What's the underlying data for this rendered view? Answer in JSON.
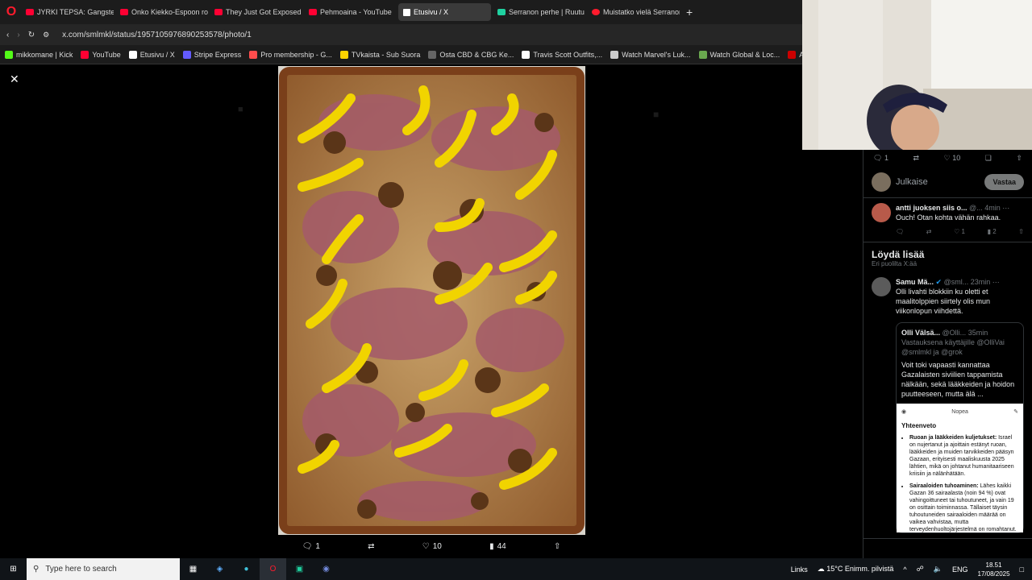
{
  "tabs": [
    {
      "label": "JYRKI TEPSA: Gangsteriel",
      "fav": "yt"
    },
    {
      "label": "Onko Kiekko-Espoon rom",
      "fav": "yt"
    },
    {
      "label": "They Just Got Exposed In",
      "fav": "yt"
    },
    {
      "label": "Pehmoaina - YouTube",
      "fav": "yt"
    },
    {
      "label": "Etusivu / X",
      "fav": "x",
      "active": true
    },
    {
      "label": "Serranon perhe | Ruutu",
      "fav": "r"
    },
    {
      "label": "Muistatko vielä Serranon",
      "fav": "o"
    }
  ],
  "address": {
    "url": "x.com/smlmkl/status/1957105976890253578/photo/1"
  },
  "bookmarks": [
    {
      "label": "mikkomane | Kick",
      "color": "#53fc18"
    },
    {
      "label": "YouTube",
      "color": "#ff0033"
    },
    {
      "label": "Etusivu / X",
      "color": "#ffffff"
    },
    {
      "label": "Stripe Express",
      "color": "#635bff"
    },
    {
      "label": "Pro membership - G...",
      "color": "#ff4d4d"
    },
    {
      "label": "TVkaista - Sub Suora",
      "color": "#ffd400"
    },
    {
      "label": "Osta CBD & CBG Ke...",
      "color": "#666666"
    },
    {
      "label": "Travis Scott Outfits,...",
      "color": "#ffffff"
    },
    {
      "label": "Watch Marvel's Luk...",
      "color": "#cccccc"
    },
    {
      "label": "Watch Global & Loc...",
      "color": "#6aa84f"
    },
    {
      "label": "A$AP ROCKY x PU...",
      "color": "#cc0000"
    }
  ],
  "photo_actions": {
    "replies": "1",
    "likes": "10",
    "views": "44"
  },
  "side": {
    "top_actions": {
      "replies": "1",
      "likes": "10"
    },
    "reply_placeholder": "Julkaise",
    "reply_button": "Vastaa",
    "reply_tweet": {
      "name": "antti juoksen siis o...",
      "handle": "@...",
      "time": "4min",
      "text": "Ouch! Otan kohta vähän rahkaa.",
      "likes": "1",
      "views": "2"
    },
    "discover_title": "Löydä lisää",
    "discover_sub": "Eri puolilta X:ää",
    "tweet2": {
      "name": "Samu Mä...",
      "handle": "@sml...",
      "time": "23min",
      "text": "Olli livahti blokkiin ku oletti et maalitolppien siirtely olis mun viikonlopun viihdettä."
    },
    "quote": {
      "name": "Olli Välsä...",
      "handle": "@Olli...",
      "time": "35min",
      "reply_to": "Vastauksena käyttäjille @OlliVai @smlmkl ja @grok",
      "text": "Voit toki vapaasti kannattaa Gazalaisten siviilien tappamista nälkään, sekä lääkkeiden ja hoidon puutteeseen, mutta älä ...",
      "inner_mode": "Nopea",
      "inner_title": "Yhteenveto",
      "inner_b1_head": "Ruoan ja lääkkeiden kuljetukset:",
      "inner_b1": "Israel on nujertanut ja ajoittain estänyt ruoan, lääkkeiden ja muiden tarvikkeiden pääsyn Gazaan, erityisesti maaliskuusta 2025 lähtien, mikä on johtanut humanitaariseen kriisiin ja nälänhätään.",
      "inner_b2_head": "Sairaaloiden tuhoaminen:",
      "inner_b2": "Lähes kaikki Gazan 36 sairaalasta (noin 94 %) ovat vahingoittuneet tai tuhoutuneet, ja vain 19 on osittain toiminnassa. Tällaiset täysin tuhoutuneiden sairaaloiden määrää on vaikea vahvistaa, mutta terveydenhuoltojärjestelmä on romahtanut."
    }
  },
  "taskbar": {
    "search_placeholder": "Type here to search",
    "links": "Links",
    "weather": "15°C Enimm. pilvistä",
    "lang": "ENG",
    "time": "18.51",
    "date": "17/08/2025"
  }
}
